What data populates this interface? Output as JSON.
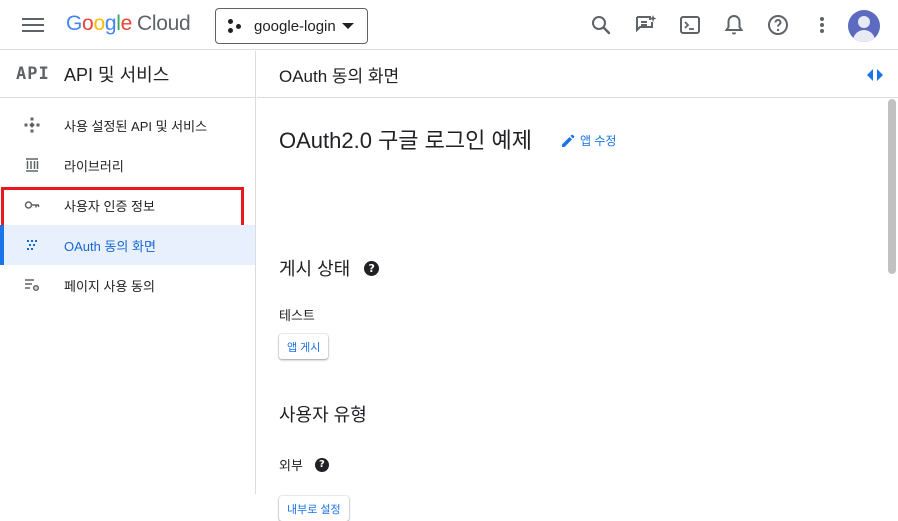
{
  "header": {
    "logo_google": "Google",
    "logo_cloud": "Cloud",
    "project_name": "google-login"
  },
  "icons": [
    "menu-icon",
    "search-icon",
    "notes-icon",
    "terminal-icon",
    "bell-icon",
    "help-icon",
    "more-vert-icon",
    "avatar"
  ],
  "sidebar": {
    "api_logo": "API",
    "title": "API 및 서비스",
    "items": [
      {
        "label": "사용 설정된 API 및 서비스",
        "icon": "api-diamond-icon"
      },
      {
        "label": "라이브러리",
        "icon": "library-icon"
      },
      {
        "label": "사용자 인증 정보",
        "icon": "key-icon"
      },
      {
        "label": "OAuth 동의 화면",
        "icon": "oauth-grid-icon"
      },
      {
        "label": "페이지 사용 동의",
        "icon": "settings-list-icon"
      }
    ]
  },
  "main": {
    "header_title": "OAuth 동의 화면",
    "app_title": "OAuth2.0 구글 로그인 예제",
    "edit_app_label": "앱 수정",
    "publish_status_heading": "게시 상태",
    "publish_status_value": "테스트",
    "publish_button": "앱 게시",
    "user_type_heading": "사용자 유형",
    "user_type_value": "외부",
    "make_internal_button": "내부로 설정"
  },
  "colors": {
    "accent": "#1a73e8",
    "active_bg": "#e8f0fe",
    "highlight_box": "#e8191e",
    "avatar": "#5c6bc0"
  }
}
